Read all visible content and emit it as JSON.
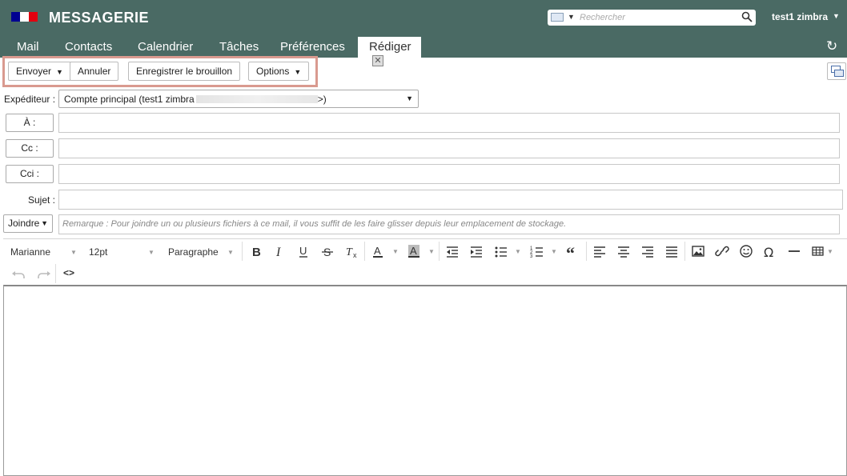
{
  "header": {
    "title": "MESSAGERIE",
    "flag_colors": [
      "#000091",
      "#ffffff",
      "#e1000f"
    ],
    "search_placeholder": "Rechercher",
    "user": "test1 zimbra",
    "accent": "#4a6a64"
  },
  "tabs": [
    {
      "label": "Mail"
    },
    {
      "label": "Contacts"
    },
    {
      "label": "Calendrier"
    },
    {
      "label": "Tâches"
    },
    {
      "label": "Préférences"
    },
    {
      "label": "Rédiger",
      "active": true
    }
  ],
  "toolbar": {
    "send": "Envoyer",
    "cancel": "Annuler",
    "save_draft": "Enregistrer le brouillon",
    "options": "Options"
  },
  "form": {
    "sender_label": "Expéditeur :",
    "sender_value": "Compte principal (test1 zimbra",
    "sender_suffix": ">)",
    "to_label": "À :",
    "cc_label": "Cc :",
    "bcc_label": "Cci :",
    "subject_label": "Sujet :",
    "attach_label": "Joindre",
    "attach_note": "Remarque : Pour joindre un ou plusieurs fichiers à ce mail, il vous suffit de les faire glisser depuis leur emplacement de stockage."
  },
  "editor": {
    "font": "Marianne",
    "size": "12pt",
    "block": "Paragraphe",
    "code_label": "<>",
    "icons": [
      "bold-icon",
      "italic-icon",
      "underline-icon",
      "strikethrough-icon",
      "clear-format-icon",
      "text-color-icon",
      "highlight-color-icon",
      "outdent-icon",
      "indent-icon",
      "bullet-list-icon",
      "numbered-list-icon",
      "blockquote-icon",
      "align-left-icon",
      "align-center-icon",
      "align-right-icon",
      "justify-icon",
      "image-icon",
      "link-icon",
      "emoji-icon",
      "special-char-icon",
      "horizontal-line-icon",
      "table-icon",
      "undo-icon",
      "redo-icon",
      "source-code-icon"
    ]
  }
}
